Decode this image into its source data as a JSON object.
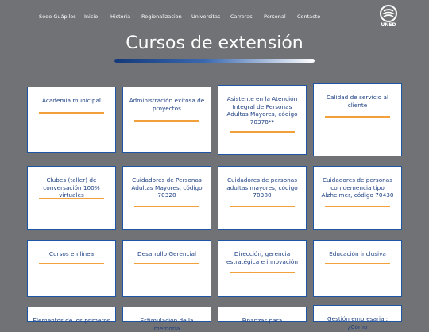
{
  "nav": {
    "items": [
      "Sede Guápiles",
      "Inicio",
      "Historia",
      "Regionalizacion",
      "Universitas",
      "Carreras",
      "Personal",
      "Contacto"
    ],
    "logo_text": "UNED"
  },
  "page": {
    "title": "Cursos de extensión"
  },
  "colors": {
    "background": "#717275",
    "card_border": "#1f56a3",
    "card_text": "#1c3f82",
    "accent_line": "#f2a13a"
  },
  "courses": [
    "Academia municipal",
    "Administración exitosa de proyectos",
    "Asistente en la Atención Integral de Personas Adultas Mayores, código 70378**",
    "Calidad de servicio al cliente",
    "Clubes (taller) de conversación 100% virtuales",
    "Cuidadores de Personas Adultas Mayores, código 70320",
    "Cuidadores de personas adultas mayores, código 70380",
    "Cuidadores de personas con demencia tipo Alzheimer, código 70430",
    "Cursos en línea",
    "Desarrollo Gerencial",
    "Dirección, gerencia estratégica e innovación",
    "Educación inclusiva",
    "Elementos de los primeros",
    "Estimulación de la memoria",
    "Finanzas para",
    "Gestión empresarial: ¿Cómo"
  ]
}
